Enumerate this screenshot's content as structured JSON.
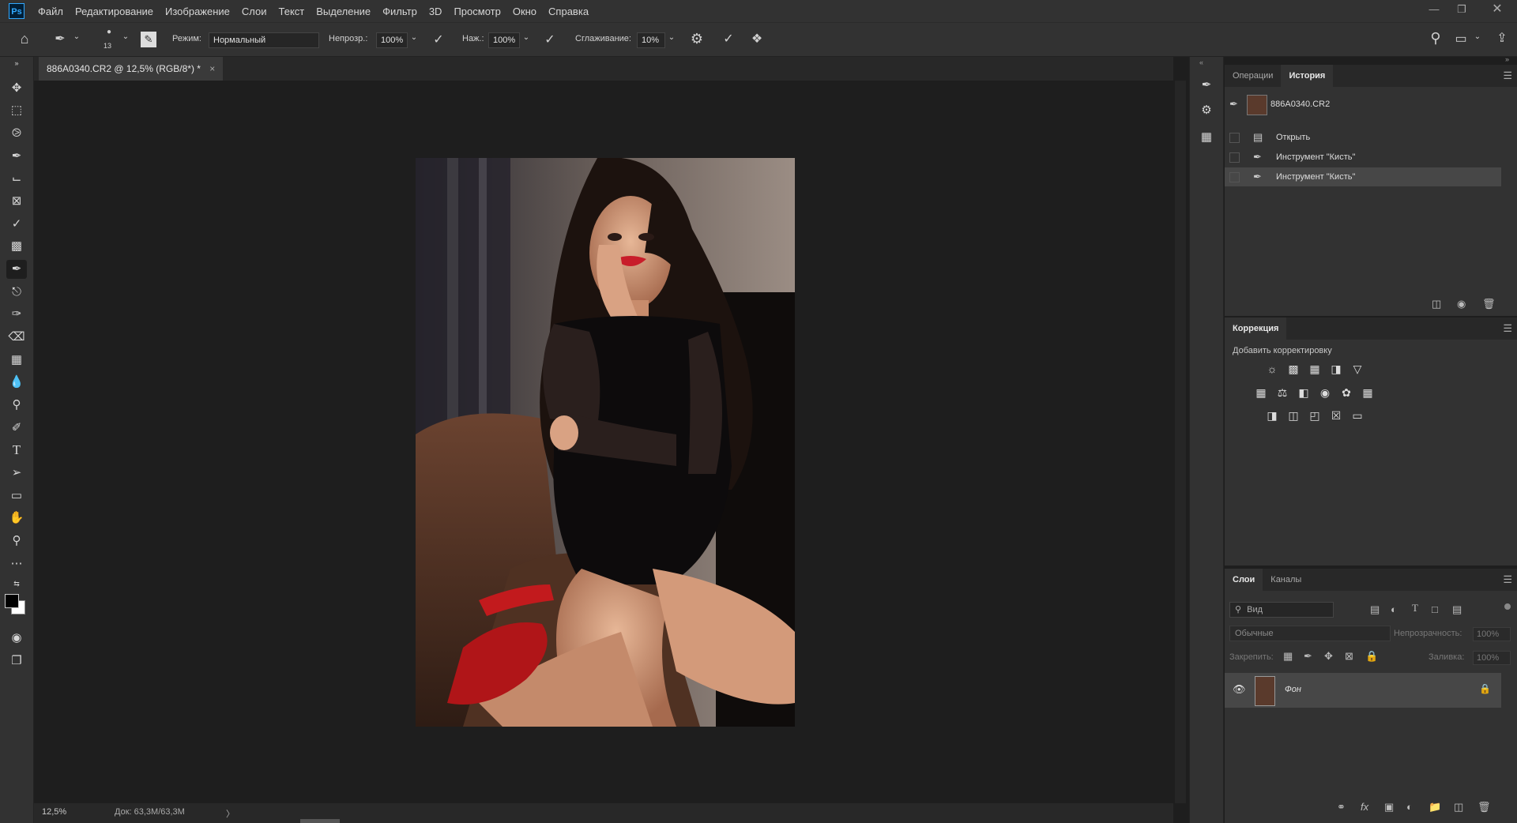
{
  "menu": {
    "app_icon": "Ps",
    "items": [
      "Файл",
      "Редактирование",
      "Изображение",
      "Слои",
      "Текст",
      "Выделение",
      "Фильтр",
      "3D",
      "Просмотр",
      "Окно",
      "Справка"
    ]
  },
  "options": {
    "brush_size": "13",
    "mode_label": "Режим:",
    "mode_value": "Нормальный",
    "opacity_label": "Непрозр.:",
    "opacity_value": "100%",
    "flow_label": "Наж.:",
    "flow_value": "100%",
    "smoothing_label": "Сглаживание:",
    "smoothing_value": "10%"
  },
  "document": {
    "tab_title": "886A0340.CR2 @ 12,5% (RGB/8*) *",
    "close_glyph": "×",
    "zoom": "12,5%",
    "doc_info": "Док: 63,3M/63,3M",
    "status_arrow": "〉"
  },
  "history_panel": {
    "tabs": [
      "Операции",
      "История"
    ],
    "snapshot": "886A0340.CR2",
    "rows": [
      "Открыть",
      "Инструмент \"Кисть\"",
      "Инструмент \"Кисть\""
    ]
  },
  "adjustments_panel": {
    "title": "Коррекция",
    "subtitle": "Добавить корректировку"
  },
  "layers_panel": {
    "tabs": [
      "Слои",
      "Каналы"
    ],
    "filter_placeholder": "Вид",
    "blend_mode": "Обычные",
    "opacity_label": "Непрозрачность:",
    "opacity_value": "100%",
    "lock_label": "Закрепить:",
    "fill_label": "Заливка:",
    "fill_value": "100%",
    "layer_name": "Фон"
  },
  "colors": {
    "bg": "#1e1e1e",
    "panel": "#323232",
    "accent": "#31a8ff"
  }
}
